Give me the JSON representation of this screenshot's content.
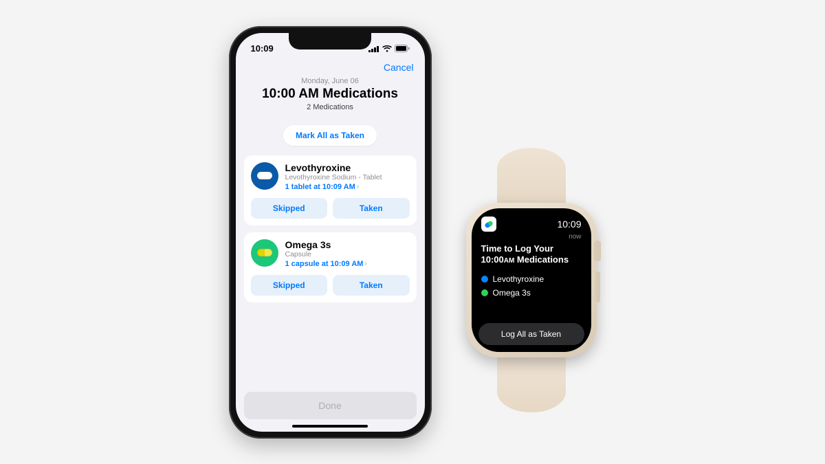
{
  "phone": {
    "status": {
      "time": "10:09"
    },
    "nav": {
      "cancel": "Cancel"
    },
    "header": {
      "date": "Monday, June 06",
      "title": "10:00 AM Medications",
      "count": "2 Medications"
    },
    "mark_all": "Mark All as Taken",
    "meds": [
      {
        "name": "Levothyroxine",
        "subtitle": "Levothyroxine Sodium - Tablet",
        "dose": "1 tablet at 10:09 AM",
        "color": "blue",
        "shape": "tablet",
        "skipped": "Skipped",
        "taken": "Taken"
      },
      {
        "name": "Omega 3s",
        "subtitle": "Capsule",
        "dose": "1 capsule at 10:09 AM",
        "color": "green",
        "shape": "capsule",
        "skipped": "Skipped",
        "taken": "Taken"
      }
    ],
    "done": "Done"
  },
  "watch": {
    "time": "10:09",
    "now": "now",
    "title_line1": "Time to Log Your",
    "title_line2_pre": "10:00",
    "title_line2_ampm": "AM",
    "title_line2_post": " Medications",
    "items": [
      {
        "color": "blue",
        "label": "Levothyroxine"
      },
      {
        "color": "green",
        "label": "Omega 3s"
      }
    ],
    "action": "Log All as Taken"
  }
}
